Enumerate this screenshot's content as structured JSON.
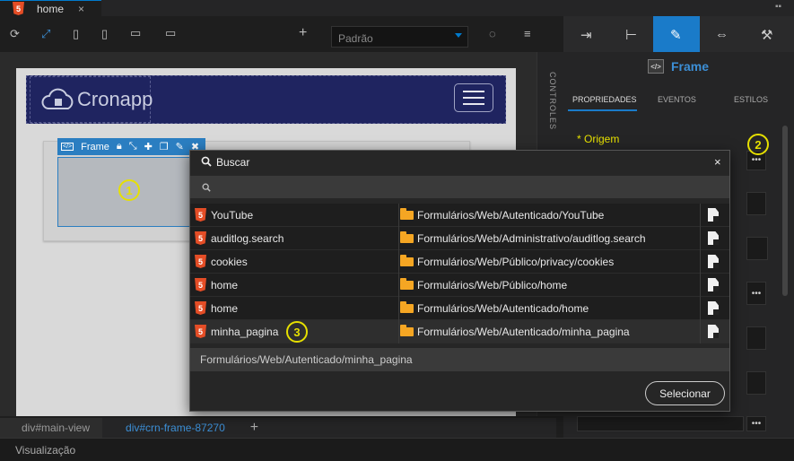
{
  "tab": {
    "label": "home",
    "close": "×",
    "icon": "html5-icon"
  },
  "toolbar": {
    "device_select": "Padrão"
  },
  "canvas": {
    "logo_text": "Cronapp",
    "frame_toolbar_label": "Frame"
  },
  "markers": {
    "m1": "1",
    "m2": "2",
    "m3": "3"
  },
  "vertical_tab": "CONTROLES",
  "breadcrumb": {
    "item1": "div#main-view",
    "item2": "div#crn-frame-87270",
    "add": "+"
  },
  "status": {
    "label": "Visualização"
  },
  "right_panel": {
    "title": "Frame",
    "tabs": [
      "PROPRIEDADES",
      "EVENTOS",
      "ESTILOS"
    ],
    "origem_label": "* Origem"
  },
  "modal": {
    "title": "Buscar",
    "close": "×",
    "rows": [
      {
        "name": "YouTube",
        "path": "Formulários/Web/Autenticado/YouTube"
      },
      {
        "name": "auditlog.search",
        "path": "Formulários/Web/Administrativo/auditlog.search"
      },
      {
        "name": "cookies",
        "path": "Formulários/Web/Público/privacy/cookies"
      },
      {
        "name": "home",
        "path": "Formulários/Web/Público/home"
      },
      {
        "name": "home",
        "path": "Formulários/Web/Autenticado/home"
      },
      {
        "name": "minha_pagina",
        "path": "Formulários/Web/Autenticado/minha_pagina"
      }
    ],
    "selected_path": "Formulários/Web/Autenticado/minha_pagina",
    "select_button": "Selecionar"
  },
  "colors": {
    "accent": "#1a7bc9",
    "marker": "#e6e000",
    "html5": "#e44d26",
    "folder": "#f5a623",
    "navbar": "#1f2460"
  }
}
